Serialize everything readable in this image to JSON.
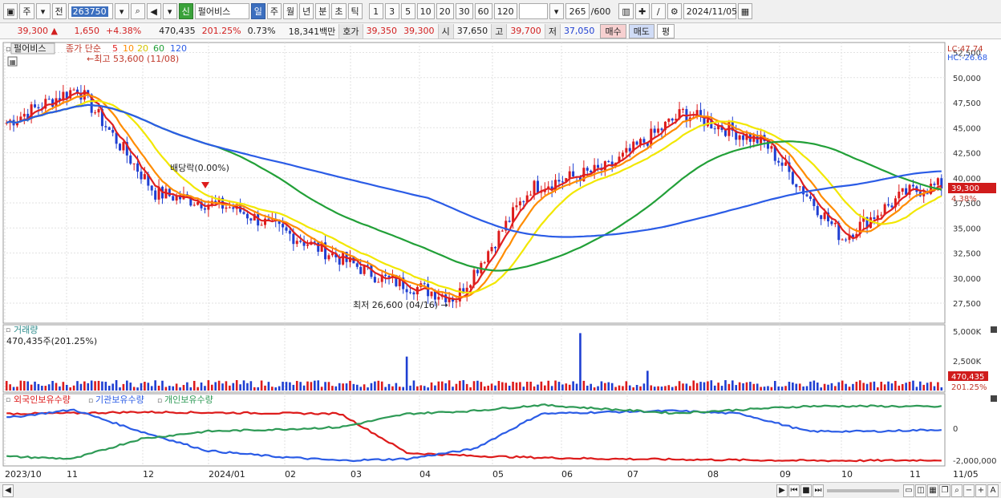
{
  "toolbar": {
    "period_main": "주",
    "prev_label": "전",
    "code": "263750",
    "new_badge": "신",
    "stock_name": "펄어비스",
    "tabs": [
      "일",
      "주",
      "월",
      "년",
      "분",
      "초",
      "틱"
    ],
    "active_tab": "일",
    "intervals": [
      "1",
      "3",
      "5",
      "10",
      "20",
      "30",
      "60",
      "120"
    ],
    "count": "265",
    "count_total": "/600",
    "date": "2024/11/05"
  },
  "quote": {
    "price": "39,300",
    "change": "1,650",
    "change_pct": "+4.38%",
    "volume": "470,435",
    "volume_ratio": "201.25%",
    "turnover_pct": "0.73%",
    "amount": "18,341백만",
    "bid_label": "호가",
    "bid1": "39,350",
    "bid2": "39,300",
    "open_label": "시",
    "open": "37,650",
    "high_label": "고",
    "high": "39,700",
    "low_label": "저",
    "low": "37,050",
    "buy_btn": "매수",
    "sell_btn": "매도",
    "eval_btn": "평"
  },
  "price_panel": {
    "name_tag": "펄어비스",
    "legend_prefix": "종가 단순",
    "ma_periods": [
      "5",
      "10",
      "20",
      "60",
      "120"
    ],
    "ma_colors": [
      "#e02020",
      "#ff8c00",
      "#f2e700",
      "#22a038",
      "#2b5ce6"
    ],
    "high_note": "최고 53,600 (11/08)",
    "low_note": "최저 26,600 (04/16)",
    "dividend_note": "배당락(0.00%)",
    "lc": "LC:47.74",
    "hc": "HC:-26.68",
    "last_price_tag": "39,300",
    "last_pct_tag": "4.38%",
    "y_ticks": [
      "52,500",
      "50,000",
      "47,500",
      "45,000",
      "42,500",
      "40,000",
      "37,500",
      "35,000",
      "32,500",
      "30,000",
      "27,500"
    ]
  },
  "volume_panel": {
    "title": "거래량",
    "value": "470,435주(201.25%)",
    "y_ticks": [
      "5,000K",
      "2,500K"
    ],
    "last_tag": "470,435",
    "last_pct": "201.25%"
  },
  "holding_panel": {
    "titles": [
      "외국인보유수량",
      "기관보유수량",
      "개인보유수량"
    ],
    "colors": [
      "#dd1b1b",
      "#2b5ce6",
      "#2e9a56"
    ],
    "y_ticks": [
      "0",
      "-2,000,000"
    ]
  },
  "x_axis": {
    "labels": [
      "2023/10",
      "11",
      "12",
      "2024/01",
      "02",
      "03",
      "04",
      "05",
      "06",
      "07",
      "08",
      "09",
      "10",
      "11",
      "11/05"
    ]
  },
  "chart_data": {
    "type": "line",
    "title": "펄어비스",
    "series": [
      {
        "name": "종가",
        "x": [
          "2023/10",
          "2023/11",
          "2023/12",
          "2024/01",
          "2024/02",
          "2024/03",
          "2024/04",
          "2024/05",
          "2024/06",
          "2024/07",
          "2024/08",
          "2024/09",
          "2024/10",
          "2024/11/05"
        ],
        "values": [
          45500,
          49000,
          38500,
          37000,
          33500,
          30000,
          28000,
          39000,
          41000,
          46500,
          43500,
          34000,
          38500,
          39300
        ]
      }
    ],
    "ylim": [
      25500,
      53500
    ],
    "highs_lows": {
      "high": 53600,
      "high_date": "11/08",
      "low": 26600,
      "low_date": "04/16"
    }
  }
}
